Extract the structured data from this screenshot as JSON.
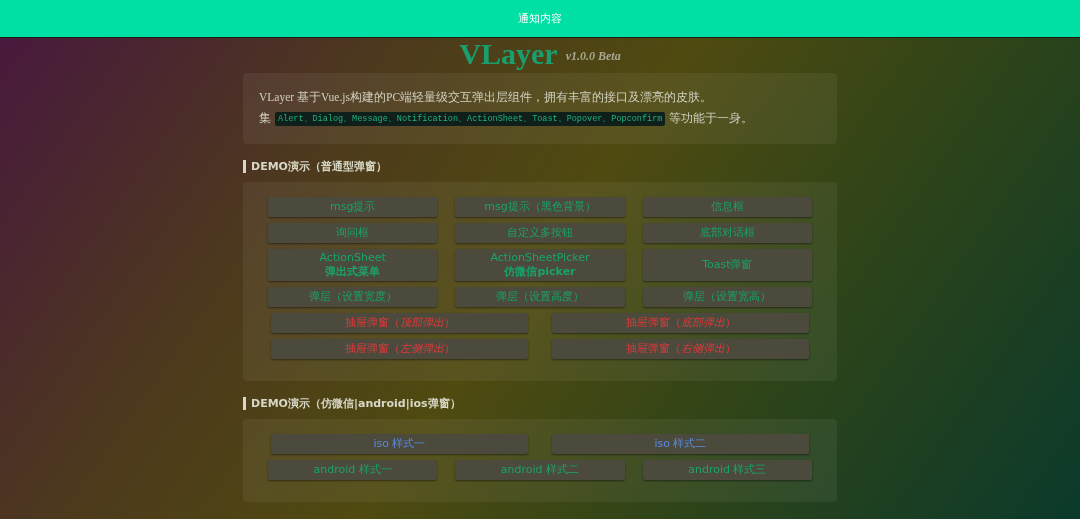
{
  "notification": {
    "text": "通知内容"
  },
  "header": {
    "title": "VLayer",
    "version": "v1.0.0 Beta"
  },
  "intro": {
    "line": "VLayer 基于Vue.js构建的PC端轻量级交互弹出层组件，拥有丰富的接口及漂亮的皮肤。",
    "prefix": "集",
    "code": "Alert、Dialog、Message、Notification、ActionSheet、Toast、Popover、Popconfirm",
    "suffix": "等功能于一身。"
  },
  "sections": [
    {
      "heading": "DEMO演示（普通型弹窗）",
      "groups": [
        {
          "buttons": [
            {
              "kind": "basic",
              "lines": [
                "msg提示"
              ]
            },
            {
              "kind": "basic",
              "lines": [
                "msg提示（黑色背景）"
              ]
            },
            {
              "kind": "basic",
              "lines": [
                "信息框"
              ]
            },
            {
              "kind": "basic",
              "lines": [
                "询问框"
              ]
            },
            {
              "kind": "basic",
              "lines": [
                "自定义多按钮"
              ]
            },
            {
              "kind": "basic",
              "lines": [
                "底部对话框"
              ]
            },
            {
              "kind": "basic",
              "lines": [
                "ActionSheet",
                "弹出式菜单"
              ]
            },
            {
              "kind": "basic",
              "lines": [
                "ActionSheetPicker",
                "仿微信picker"
              ]
            },
            {
              "kind": "basic",
              "lines": [
                "Toast弹窗"
              ]
            },
            {
              "kind": "basic",
              "lines": [
                "弹层（设置宽度）"
              ]
            },
            {
              "kind": "basic",
              "lines": [
                "弹层（设置高度）"
              ]
            },
            {
              "kind": "basic",
              "lines": [
                "弹层（设置宽高）"
              ]
            }
          ]
        },
        {
          "buttons": [
            {
              "kind": "drawer",
              "lines": [
                "抽屉弹窗（*顶部弹出*）"
              ]
            },
            {
              "kind": "drawer",
              "lines": [
                "抽屉弹窗（*底部弹出*）"
              ]
            },
            {
              "kind": "drawer",
              "lines": [
                "抽屉弹窗（*左侧弹出*）"
              ]
            },
            {
              "kind": "drawer",
              "lines": [
                "抽屉弹窗（*右侧弹出*）"
              ]
            }
          ]
        }
      ]
    },
    {
      "heading": "DEMO演示（仿微信|android|ios弹窗）",
      "groups": [
        {
          "buttons": [
            {
              "kind": "ios",
              "lines": [
                "iso 样式一"
              ]
            },
            {
              "kind": "ios",
              "lines": [
                "iso 样式二"
              ]
            }
          ]
        },
        {
          "buttons": [
            {
              "kind": "android",
              "lines": [
                "android 样式一"
              ]
            },
            {
              "kind": "android",
              "lines": [
                "android 样式二"
              ]
            },
            {
              "kind": "android",
              "lines": [
                "android 样式三"
              ]
            }
          ]
        }
      ]
    }
  ]
}
